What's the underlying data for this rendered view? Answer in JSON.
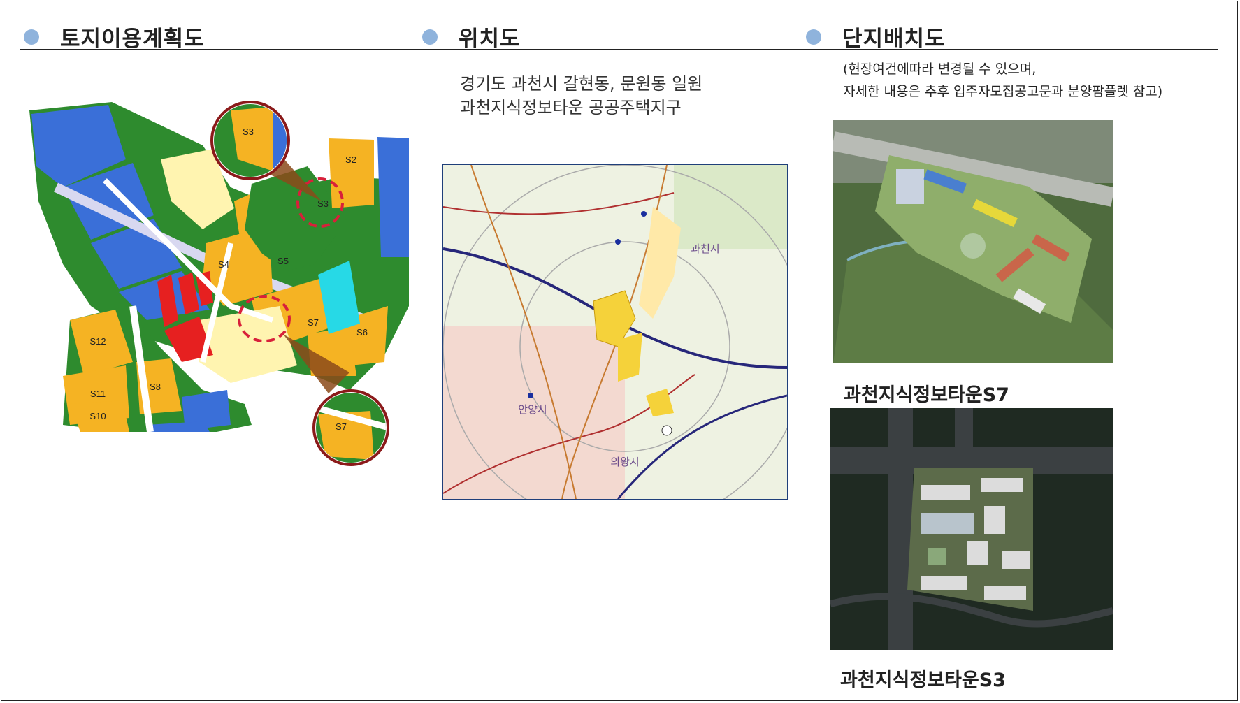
{
  "sections": {
    "land_use": {
      "title": "토지이용계획도",
      "map_labels": [
        "S3",
        "S2",
        "S4",
        "S5",
        "S6",
        "S7",
        "S8",
        "S10",
        "S11",
        "S12"
      ]
    },
    "location": {
      "title": "위치도",
      "address_line1": "경기도 과천시 갈현동, 문원동 일원",
      "address_line2": "과천지식정보타운 공공주택지구",
      "map_labels": [
        "과천시",
        "안양시",
        "의왕시"
      ]
    },
    "site_plan": {
      "title": "단지배치도",
      "note_line1": "(현장여건에따라 변경될 수 있으며,",
      "note_line2": "자세한 내용은 추후 입주자모집공고문과 분양팜플렛 참고)",
      "caption_s7": "과천지식정보타운S7",
      "caption_s3": "과천지식정보타운S3"
    }
  },
  "colors": {
    "bullet": "#8fb3dc",
    "residential": "#f5b323",
    "park": "#2e8b2e",
    "commercial": "#e62020",
    "public": "#3a6fd8",
    "highlight_ring": "#d8203a"
  }
}
